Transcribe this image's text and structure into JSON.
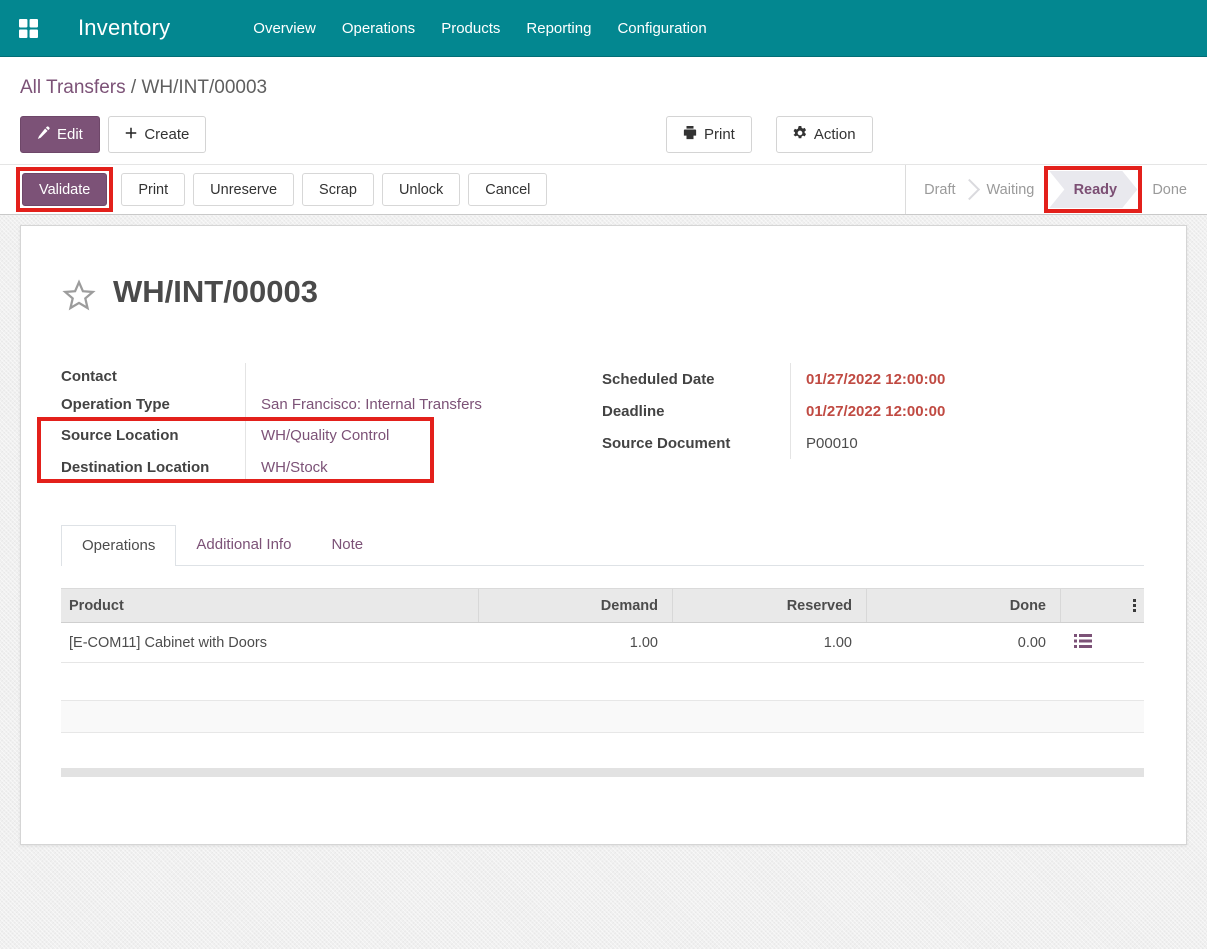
{
  "colors": {
    "navbar_teal": "#038790",
    "accent_purple": "#7c5277",
    "danger_red": "#c04a42",
    "annotation_red": "#e3201b",
    "stage_ready_bg": "#e9e9ee"
  },
  "navbar": {
    "app_title": "Inventory",
    "menu_items": [
      {
        "label": "Overview"
      },
      {
        "label": "Operations"
      },
      {
        "label": "Products"
      },
      {
        "label": "Reporting"
      },
      {
        "label": "Configuration"
      }
    ]
  },
  "breadcrumb": {
    "parent": "All Transfers",
    "separator": "/",
    "current": "WH/INT/00003"
  },
  "actions": {
    "edit": "Edit",
    "create": "Create",
    "print": "Print",
    "action": "Action"
  },
  "statusbar": {
    "buttons": [
      {
        "label": "Validate"
      },
      {
        "label": "Print"
      },
      {
        "label": "Unreserve"
      },
      {
        "label": "Scrap"
      },
      {
        "label": "Unlock"
      },
      {
        "label": "Cancel"
      }
    ],
    "stages": [
      {
        "label": "Draft"
      },
      {
        "label": "Waiting"
      },
      {
        "label": "Ready",
        "active": true
      },
      {
        "label": "Done"
      }
    ]
  },
  "form": {
    "title": "WH/INT/00003",
    "fields_left": [
      {
        "label": "Contact",
        "value": ""
      },
      {
        "label": "Operation Type",
        "value": "San Francisco: Internal Transfers"
      },
      {
        "label": "Source Location",
        "value": "WH/Quality Control"
      },
      {
        "label": "Destination Location",
        "value": "WH/Stock"
      }
    ],
    "fields_right": [
      {
        "label": "Scheduled Date",
        "value": "01/27/2022 12:00:00"
      },
      {
        "label": "Deadline",
        "value": "01/27/2022 12:00:00"
      },
      {
        "label": "Source Document",
        "value": "P00010"
      }
    ],
    "tabs": [
      {
        "label": "Operations"
      },
      {
        "label": "Additional Info"
      },
      {
        "label": "Note"
      }
    ]
  },
  "operations_table": {
    "columns": [
      {
        "label": "Product"
      },
      {
        "label": "Demand"
      },
      {
        "label": "Reserved"
      },
      {
        "label": "Done"
      }
    ],
    "header_options_icon": "vertical-ellipsis-icon",
    "rows": [
      {
        "product": "[E-COM11] Cabinet with Doors",
        "demand": "1.00",
        "reserved": "1.00",
        "done": "0.00",
        "row_icon": "detailed-operations-icon"
      }
    ]
  }
}
